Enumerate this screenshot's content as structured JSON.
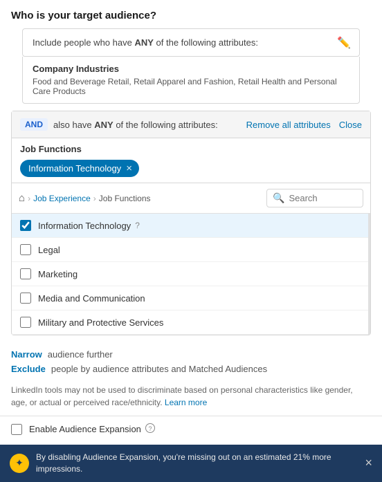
{
  "page": {
    "title": "Who is your target audience?"
  },
  "any_attributes": {
    "text_prefix": "Include people who have ",
    "bold_word": "ANY",
    "text_suffix": " of the following attributes:"
  },
  "company_industries": {
    "label": "Company Industries",
    "value": "Food and Beverage Retail, Retail Apparel and Fashion, Retail Health and Personal Care Products"
  },
  "and_block": {
    "badge": "AND",
    "text_prefix": "also have ",
    "bold_word": "ANY",
    "text_suffix": " of the following attributes:",
    "remove_all_label": "Remove all attributes",
    "close_label": "Close"
  },
  "job_functions": {
    "label": "Job Functions",
    "tag": "Information Technology",
    "tag_close_symbol": "×"
  },
  "breadcrumb": {
    "home_symbol": "⌂",
    "separator": "›",
    "link": "Job Experience",
    "current": "Job Functions"
  },
  "search": {
    "placeholder": "Search",
    "icon": "🔍"
  },
  "checkbox_items": [
    {
      "id": "it",
      "label": "Information Technology",
      "checked": true,
      "has_help": true
    },
    {
      "id": "legal",
      "label": "Legal",
      "checked": false,
      "has_help": false
    },
    {
      "id": "marketing",
      "label": "Marketing",
      "checked": false,
      "has_help": false
    },
    {
      "id": "media",
      "label": "Media and Communication",
      "checked": false,
      "has_help": false
    },
    {
      "id": "military",
      "label": "Military and Protective Services",
      "checked": false,
      "has_help": false
    }
  ],
  "narrow": {
    "link_label": "Narrow",
    "text": "audience further"
  },
  "exclude": {
    "link_label": "Exclude",
    "text": "people by audience attributes and Matched Audiences"
  },
  "disclaimer": {
    "text": "LinkedIn tools may not be used to discriminate based on personal characteristics like gender, age, or actual or perceived race/ethnicity.",
    "learn_more": "Learn more"
  },
  "enable_expansion": {
    "label": "Enable Audience Expansion",
    "help_symbol": "?"
  },
  "banner": {
    "icon": "✦",
    "text": "By disabling Audience Expansion, you're missing out on an estimated 21% more impressions.",
    "close_symbol": "×"
  }
}
